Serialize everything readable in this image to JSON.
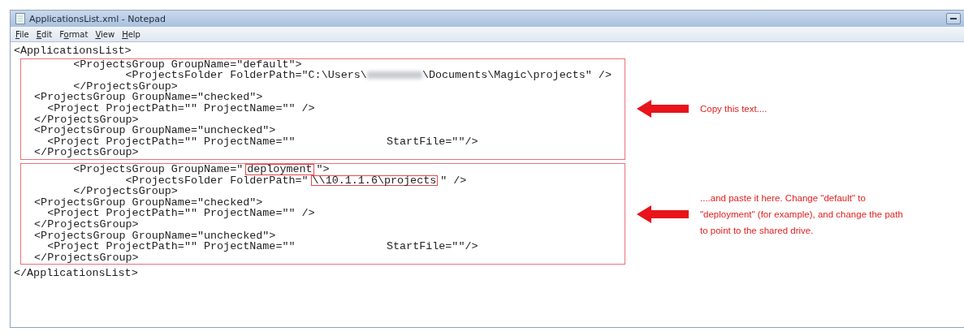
{
  "window": {
    "title": "ApplicationsList.xml - Notepad"
  },
  "menu": [
    {
      "key": "F",
      "rest": "ile"
    },
    {
      "key": "E",
      "rest": "dit"
    },
    {
      "pre": "F",
      "key": "o",
      "rest": "rmat"
    },
    {
      "key": "V",
      "rest": "iew"
    },
    {
      "key": "H",
      "rest": "elp"
    }
  ],
  "document": {
    "opening": "<ApplicationsList>",
    "blocks": [
      {
        "lines": [
          [
            {
              "kind": "plain",
              "text": "        <ProjectsGroup GroupName=\"default\">"
            }
          ],
          [
            {
              "kind": "plain",
              "text": "                <ProjectsFolder FolderPath=\"C:\\Users\\"
            },
            {
              "kind": "redacted"
            },
            {
              "kind": "plain",
              "text": "\\Documents\\Magic\\projects\" />"
            }
          ],
          [
            {
              "kind": "plain",
              "text": "        </ProjectsGroup>"
            }
          ],
          [
            {
              "kind": "plain",
              "text": "  <ProjectsGroup GroupName=\"checked\">"
            }
          ],
          [
            {
              "kind": "plain",
              "text": "    <Project ProjectPath=\"\" ProjectName=\"\" />"
            }
          ],
          [
            {
              "kind": "plain",
              "text": "  </ProjectsGroup>"
            }
          ],
          [
            {
              "kind": "plain",
              "text": "  <ProjectsGroup GroupName=\"unchecked\">"
            }
          ],
          [
            {
              "kind": "plain",
              "text": "    <Project ProjectPath=\"\" ProjectName=\"\"              StartFile=\"\"/>"
            }
          ],
          [
            {
              "kind": "plain",
              "text": "  </ProjectsGroup>"
            }
          ]
        ],
        "note": "Copy this text...."
      },
      {
        "lines": [
          [
            {
              "kind": "plain",
              "text": "        <ProjectsGroup GroupName=\""
            },
            {
              "kind": "boxed",
              "text": "deployment"
            },
            {
              "kind": "plain",
              "text": "\">"
            }
          ],
          [
            {
              "kind": "plain",
              "text": "                <ProjectsFolder FolderPath=\""
            },
            {
              "kind": "boxed",
              "text": "\\\\10.1.1.6\\projects"
            },
            {
              "kind": "plain",
              "text": "\" />"
            }
          ],
          [
            {
              "kind": "plain",
              "text": "        </ProjectsGroup>"
            }
          ],
          [
            {
              "kind": "plain",
              "text": "  <ProjectsGroup GroupName=\"checked\">"
            }
          ],
          [
            {
              "kind": "plain",
              "text": "    <Project ProjectPath=\"\" ProjectName=\"\" />"
            }
          ],
          [
            {
              "kind": "plain",
              "text": "  </ProjectsGroup>"
            }
          ],
          [
            {
              "kind": "plain",
              "text": "  <ProjectsGroup GroupName=\"unchecked\">"
            }
          ],
          [
            {
              "kind": "plain",
              "text": "    <Project ProjectPath=\"\" ProjectName=\"\"              StartFile=\"\"/>"
            }
          ],
          [
            {
              "kind": "plain",
              "text": "  </ProjectsGroup>"
            }
          ]
        ],
        "note": "....and paste it here. Change \"default\" to \"deployment\" (for example), and change the path to point to the shared drive."
      }
    ],
    "closing": "</ApplicationsList>"
  }
}
